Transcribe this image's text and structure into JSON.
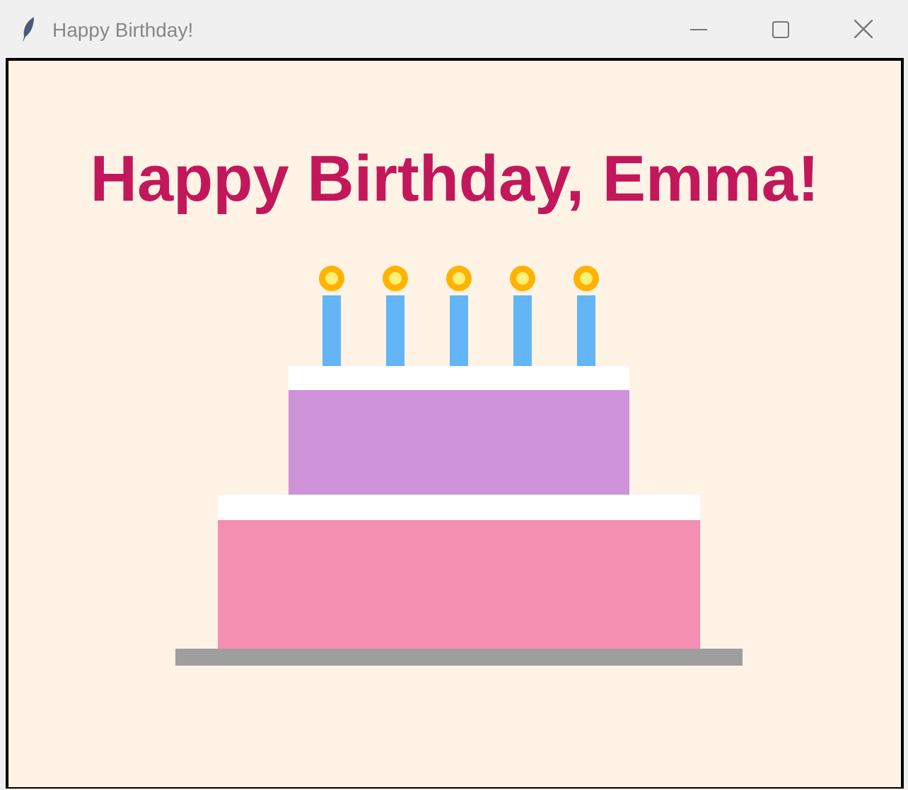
{
  "window": {
    "title": "Happy Birthday!"
  },
  "canvas": {
    "heading": "Happy Birthday, Emma!"
  }
}
